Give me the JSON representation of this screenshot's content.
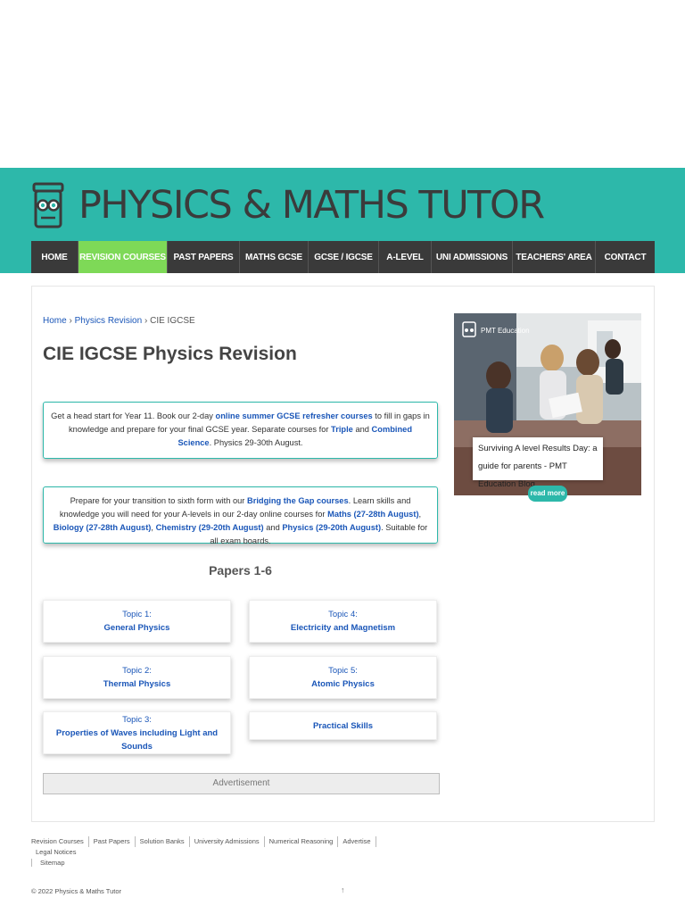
{
  "site": {
    "title": "PHYSICS & MATHS TUTOR"
  },
  "nav": {
    "items": [
      {
        "label": "HOME"
      },
      {
        "label": "REVISION COURSES"
      },
      {
        "label": "PAST PAPERS"
      },
      {
        "label": "MATHS GCSE"
      },
      {
        "label": "GCSE / IGCSE"
      },
      {
        "label": "A-LEVEL"
      },
      {
        "label": "UNI ADMISSIONS"
      },
      {
        "label": "TEACHERS' AREA"
      },
      {
        "label": "CONTACT"
      }
    ],
    "active_index": 1
  },
  "breadcrumb": {
    "home": "Home",
    "sep1": "›",
    "physics": "Physics Revision",
    "sep2": "›",
    "current": "CIE IGCSE"
  },
  "page_title": "CIE IGCSE Physics Revision",
  "promo1": {
    "t1": "Get a head start for Year 11. Book our 2-day ",
    "l1": "online summer GCSE refresher courses",
    "t2": " to fill in gaps in knowledge and prepare for your final GCSE year. Separate courses for ",
    "l2": "Triple",
    "t3": " and ",
    "l3": "Combined Science",
    "t4": ". Physics 29-30th August."
  },
  "promo2": {
    "t1": "Prepare for your transition to sixth form with our ",
    "l1": "Bridging the Gap courses",
    "t2": ". Learn skills and knowledge you will need for your A-levels in our 2-day online courses for ",
    "l2": "Maths (27-28th August)",
    "t3": ", ",
    "l3": "Biology (27-28th August)",
    "t4": ", ",
    "l4": "Chemistry (29-20th August)",
    "t5": " and ",
    "l5": "Physics (29-20th August)",
    "t6": ". Suitable for all exam boards."
  },
  "papers_heading": "Papers 1-6",
  "topics": [
    {
      "num": "Topic 1:",
      "name": "General Physics"
    },
    {
      "num": "Topic 4:",
      "name": "Electricity and Magnetism"
    },
    {
      "num": "Topic 2:",
      "name": "Thermal Physics"
    },
    {
      "num": "Topic 5:",
      "name": "Atomic Physics"
    },
    {
      "num": "Topic 3:",
      "name": "Properties of Waves including Light and Sounds"
    },
    {
      "num": "",
      "name": "Practical Skills"
    }
  ],
  "advertisement": "Advertisement",
  "sidebar": {
    "image_badge": "PMT Education",
    "blog_title": "Surviving A level Results Day: a guide for parents - PMT Education Blog",
    "read_more": "read more"
  },
  "footer": {
    "links": [
      "Revision Courses",
      "Past Papers",
      "Solution Banks",
      "University Admissions",
      "Numerical Reasoning",
      "Advertise",
      "Legal Notices",
      "Sitemap"
    ],
    "copyright": "© 2022 Physics & Maths Tutor",
    "up": "↑"
  },
  "colors": {
    "brand_teal": "#2db8aa",
    "nav_dark": "#3a3a3a",
    "nav_active": "#7ed957",
    "link_blue": "#1a56b8"
  }
}
